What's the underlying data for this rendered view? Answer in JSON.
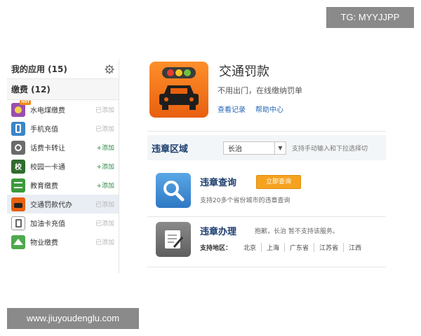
{
  "watermarks": {
    "top": "TG: MYYJJPP",
    "bottom": "www.jiuyoudenglu.com"
  },
  "sidebar": {
    "my_apps_title": "我的应用 (15)",
    "section_title": "缴费 (12)",
    "items": [
      {
        "label": "水电煤缴费",
        "action": "已添加",
        "state": "added",
        "icon": "utility-bill-icon",
        "color": "#9a4fb0",
        "glyph": "",
        "hot": "HOT"
      },
      {
        "label": "手机充值",
        "action": "已添加",
        "state": "added",
        "icon": "phone-recharge-icon",
        "color": "#3a86c8",
        "glyph": "▯"
      },
      {
        "label": "话费卡转让",
        "action": "+添加",
        "state": "add",
        "icon": "phone-card-icon",
        "color": "#6b6b6b",
        "glyph": "⚙"
      },
      {
        "label": "校园一卡通",
        "action": "+添加",
        "state": "add",
        "icon": "campus-card-icon",
        "color": "#2f6b2f",
        "glyph": "校"
      },
      {
        "label": "教育缴费",
        "action": "+添加",
        "state": "add",
        "icon": "education-fee-icon",
        "color": "#3a9a3a",
        "glyph": "≡"
      },
      {
        "label": "交通罚款代办",
        "action": "已添加",
        "state": "added",
        "icon": "traffic-fine-icon",
        "color": "#e8600f",
        "glyph": "▣"
      },
      {
        "label": "加油卡充值",
        "action": "已添加",
        "state": "added",
        "icon": "fuel-card-icon",
        "color": "#7a7a7a",
        "glyph": "⛽"
      },
      {
        "label": "物业缴费",
        "action": "已添加",
        "state": "added",
        "icon": "property-fee-icon",
        "color": "#4ea84e",
        "glyph": "⌂"
      }
    ]
  },
  "app": {
    "title": "交通罚款",
    "desc": "不用出门，在线缴纳罚单",
    "link_records": "查看记录",
    "link_help": "帮助中心"
  },
  "region": {
    "label": "违章区域",
    "city": "长治",
    "hint": "支持手动输入和下拉选择切"
  },
  "query": {
    "title": "违章查询",
    "button": "立即查询",
    "sub": "支持20多个省份城市的违章查询"
  },
  "handle": {
    "title": "违章办理",
    "note": "抱歉，长治 暂不支持该服务。",
    "regions_label": "支持地区：",
    "regions": [
      "北京",
      "上海",
      "广东省",
      "江苏省",
      "江西"
    ]
  },
  "colors": {
    "accent_orange": "#e8600f",
    "title_blue": "#1c3d6e",
    "link_blue": "#2466b8",
    "button_orange": "#f5a21f"
  }
}
